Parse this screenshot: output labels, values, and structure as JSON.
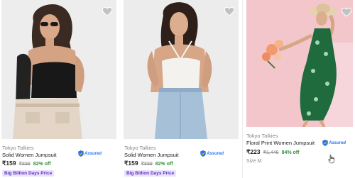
{
  "colors": {
    "accent": "#2874f0",
    "discount": "#388e3c",
    "badge_text": "#5b2ec4",
    "badge_bg": "#e9e2fb"
  },
  "products": [
    {
      "brand": "Tokyo Talkies",
      "title": "Solid Women Jumpsuit",
      "assured": "Assured",
      "price": "₹159",
      "mrp": "₹899",
      "discount": "82% off",
      "badge": "Big Billion Days Price",
      "icon": "heart-icon"
    },
    {
      "brand": "Tokyo Talkies",
      "title": "Solid Women Jumpsuit",
      "assured": "Assured",
      "price": "₹159",
      "mrp": "₹899",
      "discount": "82% off",
      "badge": "Big Billion Days Price",
      "icon": "heart-icon"
    },
    {
      "brand": "Tokyo Talkies",
      "title": "Floral Print Women Jumpsuit",
      "assured": "Assured",
      "price": "₹223",
      "mrp": "₹1,449",
      "discount": "84% off",
      "size": "Size M",
      "icon": "heart-icon"
    }
  ]
}
